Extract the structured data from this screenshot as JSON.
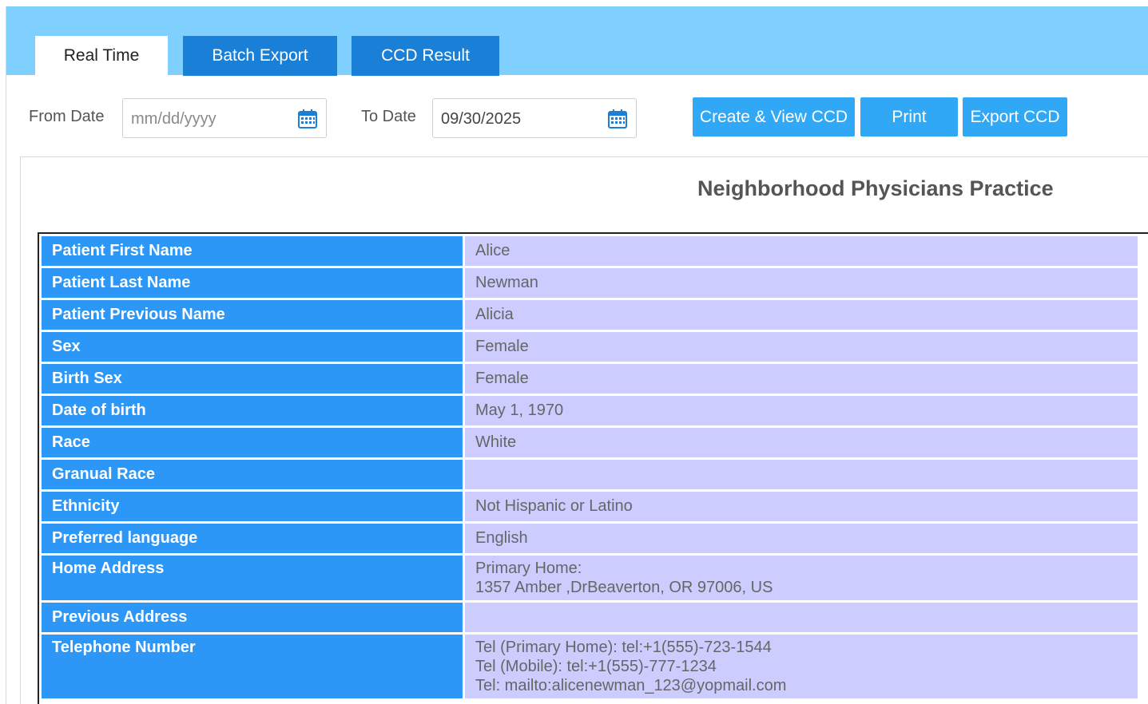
{
  "tabs": {
    "real_time": "Real Time",
    "batch_export": "Batch Export",
    "ccd_result": "CCD Result"
  },
  "filters": {
    "from_label": "From Date",
    "from_placeholder": "mm/dd/yyyy",
    "to_label": "To Date",
    "to_value": "09/30/2025"
  },
  "actions": {
    "create_view": "Create & View CCD",
    "print": "Print",
    "export": "Export CCD"
  },
  "practice_name": "Neighborhood Physicians Practice",
  "patient": {
    "first_name_label": "Patient First Name",
    "first_name": "Alice",
    "last_name_label": "Patient Last Name",
    "last_name": "Newman",
    "prev_name_label": "Patient Previous Name",
    "prev_name": "Alicia",
    "sex_label": "Sex",
    "sex": "Female",
    "birth_sex_label": "Birth Sex",
    "birth_sex": "Female",
    "dob_label": "Date of birth",
    "dob": "May 1, 1970",
    "race_label": "Race",
    "race": "White",
    "granual_race_label": "Granual Race",
    "granual_race": "",
    "ethnicity_label": "Ethnicity",
    "ethnicity": "Not Hispanic or Latino",
    "language_label": "Preferred language",
    "language": "English",
    "home_address_label": "Home Address",
    "home_address_line1": "Primary Home:",
    "home_address_line2": "1357 Amber ,DrBeaverton, OR 97006, US",
    "prev_address_label": "Previous Address",
    "prev_address": "",
    "telephone_label": "Telephone Number",
    "tel_primary": "Tel (Primary Home): tel:+1(555)-723-1544",
    "tel_mobile": "Tel (Mobile): tel:+1(555)-777-1234",
    "tel_email": "Tel: mailto:alicenewman_123@yopmail.com"
  },
  "colors": {
    "topbar": "#7fcfff",
    "tab_inactive": "#1a7fd6",
    "button": "#31a8f5",
    "label_cell": "#2c97f7",
    "value_cell": "#ccccff"
  },
  "icons": {
    "date_picker": "calendar-icon"
  }
}
